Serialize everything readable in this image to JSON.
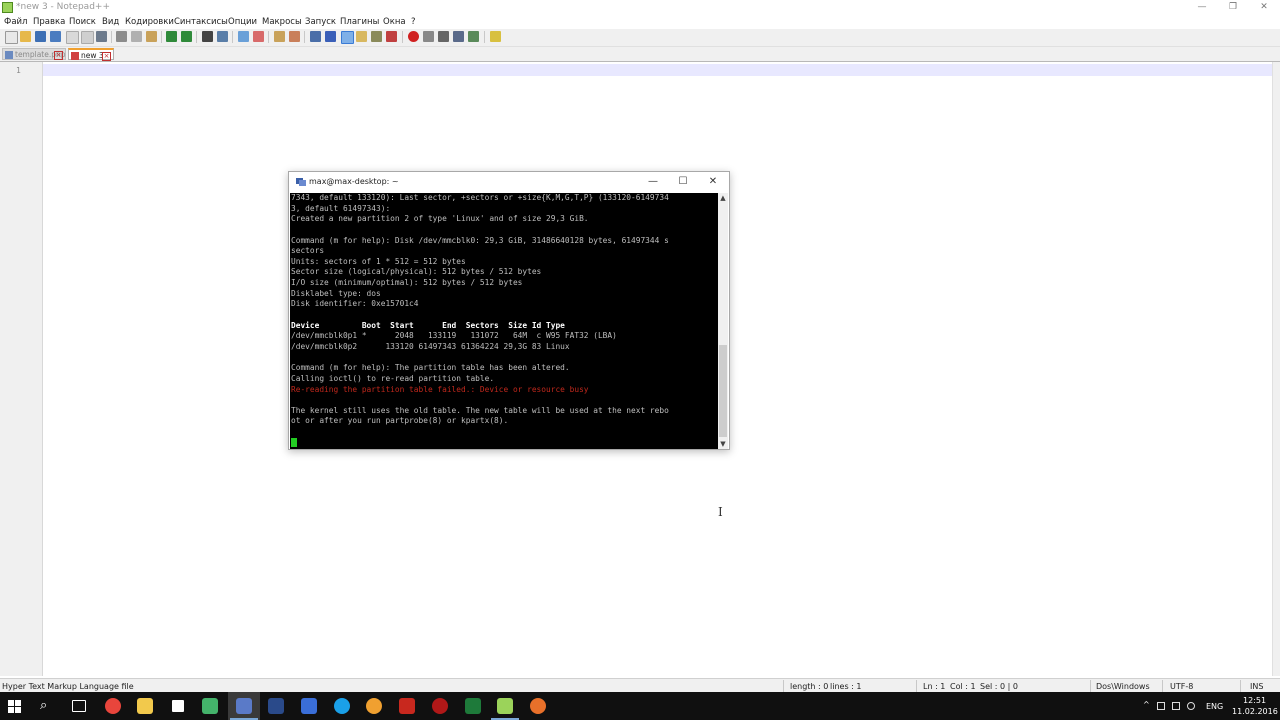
{
  "notepad": {
    "title": "*new 3 - Notepad++",
    "controls": {
      "minimize": "—",
      "restore": "❐",
      "close": "✕"
    },
    "menu": [
      "Файл",
      "Правка",
      "Поиск",
      "Вид",
      "Кодировки",
      "Синтаксисы",
      "Опции",
      "Макросы",
      "Запуск",
      "Плагины",
      "Окна",
      "?"
    ],
    "tabs": [
      {
        "label": "template.php",
        "active": false
      },
      {
        "label": "new 3",
        "active": true
      }
    ],
    "tab_close": "×",
    "line_number": "1",
    "status": {
      "file_type": "Hyper Text Markup Language file",
      "length": "length : 0",
      "lines": "lines : 1",
      "ln": "Ln : 1",
      "col": "Col : 1",
      "sel": "Sel : 0 | 0",
      "eol": "Dos\\Windows",
      "encoding": "UTF-8",
      "mode": "INS"
    }
  },
  "terminal": {
    "title": "max@max-desktop: ~",
    "controls": {
      "minimize": "—",
      "maximize": "☐",
      "close": "✕"
    },
    "scroll_up": "▲",
    "scroll_down": "▼",
    "lines": [
      {
        "text": "7343, default 133120): Last sector, +sectors or +size{K,M,G,T,P} (133120-6149734",
        "style": "normal"
      },
      {
        "text": "3, default 61497343):",
        "style": "normal"
      },
      {
        "text": "Created a new partition 2 of type 'Linux' and of size 29,3 GiB.",
        "style": "normal"
      },
      {
        "text": "",
        "style": "normal"
      },
      {
        "text": "Command (m for help): Disk /dev/mmcblk0: 29,3 GiB, 31486640128 bytes, 61497344 s",
        "style": "normal"
      },
      {
        "text": "sectors",
        "style": "normal"
      },
      {
        "text": "Units: sectors of 1 * 512 = 512 bytes",
        "style": "normal"
      },
      {
        "text": "Sector size (logical/physical): 512 bytes / 512 bytes",
        "style": "normal"
      },
      {
        "text": "I/O size (minimum/optimal): 512 bytes / 512 bytes",
        "style": "normal"
      },
      {
        "text": "Disklabel type: dos",
        "style": "normal"
      },
      {
        "text": "Disk identifier: 0xe15701c4",
        "style": "normal"
      },
      {
        "text": "",
        "style": "normal"
      },
      {
        "text": "Device         Boot  Start      End  Sectors  Size Id Type",
        "style": "bold"
      },
      {
        "text": "/dev/mmcblk0p1 *      2048   133119   131072   64M  c W95 FAT32 (LBA)",
        "style": "normal"
      },
      {
        "text": "/dev/mmcblk0p2      133120 61497343 61364224 29,3G 83 Linux",
        "style": "normal"
      },
      {
        "text": "",
        "style": "normal"
      },
      {
        "text": "Command (m for help): The partition table has been altered.",
        "style": "normal"
      },
      {
        "text": "Calling ioctl() to re-read partition table.",
        "style": "normal"
      },
      {
        "text": "Re-reading the partition table failed.: Device or resource busy",
        "style": "error"
      },
      {
        "text": "",
        "style": "normal"
      },
      {
        "text": "The kernel still uses the old table. The new table will be used at the next rebo",
        "style": "normal"
      },
      {
        "text": "ot or after you run partprobe(8) or kpartx(8).",
        "style": "normal"
      }
    ]
  },
  "taskbar": {
    "language": "ENG",
    "time": "12:51",
    "date": "11.02.2016",
    "tray_chevron": "^",
    "search_glyph": "⌕",
    "colors": {
      "background": "#101010",
      "accent": "#7aa7d6"
    }
  },
  "colors": {
    "terminal_bg": "#000000",
    "terminal_text": "#bfbfbf",
    "terminal_error": "#c0281c",
    "cursor": "#22cc22",
    "current_line": "#e8e8ff"
  }
}
